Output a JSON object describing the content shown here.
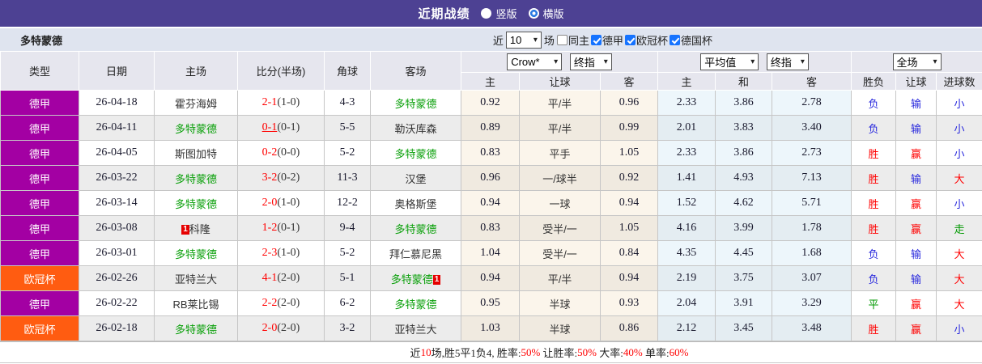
{
  "title_bar": {
    "title": "近期战绩",
    "radio_vertical": "竖版",
    "radio_horizontal": "横版"
  },
  "toolbar": {
    "team_name": "多特蒙德",
    "recent_label": "近",
    "recent_count": "10",
    "matches_label": "场",
    "filters": [
      {
        "label": "同主",
        "checked": false
      },
      {
        "label": "德甲",
        "checked": true
      },
      {
        "label": "欧冠杯",
        "checked": true
      },
      {
        "label": "德国杯",
        "checked": true
      }
    ]
  },
  "table": {
    "columns_left": [
      "类型",
      "日期",
      "主场",
      "比分(半场)",
      "角球",
      "客场"
    ],
    "odds_selects": {
      "asian_company": "Crow*",
      "asian_stage": "终指",
      "euro_company": "平均值",
      "euro_stage": "终指",
      "result_scope": "全场"
    },
    "sub_headers": [
      "主",
      "让球",
      "客",
      "主",
      "和",
      "客",
      "胜负",
      "让球",
      "进球数"
    ],
    "rows": [
      {
        "league": "德甲",
        "date": "26-04-18",
        "home": {
          "name": "霍芬海姆",
          "green": false
        },
        "score": "2-1",
        "half": "(1-0)",
        "score_underline": false,
        "corner": "4-3",
        "away": {
          "name": "多特蒙德",
          "green": true
        },
        "asian": [
          "0.92",
          "平/半",
          "0.96"
        ],
        "euro": [
          "2.33",
          "3.86",
          "2.78"
        ],
        "results": [
          {
            "text": "负",
            "color": "blue"
          },
          {
            "text": "输",
            "color": "blue"
          },
          {
            "text": "小",
            "color": "blue"
          }
        ]
      },
      {
        "league": "德甲",
        "date": "26-04-11",
        "home": {
          "name": "多特蒙德",
          "green": true
        },
        "score": "0-1",
        "half": "(0-1)",
        "score_underline": true,
        "corner": "5-5",
        "away": {
          "name": "勒沃库森",
          "green": false
        },
        "asian": [
          "0.89",
          "平/半",
          "0.99"
        ],
        "euro": [
          "2.01",
          "3.83",
          "3.40"
        ],
        "results": [
          {
            "text": "负",
            "color": "blue"
          },
          {
            "text": "输",
            "color": "blue"
          },
          {
            "text": "小",
            "color": "blue"
          }
        ]
      },
      {
        "league": "德甲",
        "date": "26-04-05",
        "home": {
          "name": "斯图加特",
          "green": false
        },
        "score": "0-2",
        "half": "(0-0)",
        "score_underline": false,
        "corner": "5-2",
        "away": {
          "name": "多特蒙德",
          "green": true
        },
        "asian": [
          "0.83",
          "平手",
          "1.05"
        ],
        "euro": [
          "2.33",
          "3.86",
          "2.73"
        ],
        "results": [
          {
            "text": "胜",
            "color": "red"
          },
          {
            "text": "赢",
            "color": "red"
          },
          {
            "text": "小",
            "color": "blue"
          }
        ]
      },
      {
        "league": "德甲",
        "date": "26-03-22",
        "home": {
          "name": "多特蒙德",
          "green": true
        },
        "score": "3-2",
        "half": "(0-2)",
        "score_underline": false,
        "corner": "11-3",
        "away": {
          "name": "汉堡",
          "green": false
        },
        "asian": [
          "0.96",
          "一/球半",
          "0.92"
        ],
        "euro": [
          "1.41",
          "4.93",
          "7.13"
        ],
        "results": [
          {
            "text": "胜",
            "color": "red"
          },
          {
            "text": "输",
            "color": "blue"
          },
          {
            "text": "大",
            "color": "red"
          }
        ]
      },
      {
        "league": "德甲",
        "date": "26-03-14",
        "home": {
          "name": "多特蒙德",
          "green": true
        },
        "score": "2-0",
        "half": "(1-0)",
        "score_underline": false,
        "corner": "12-2",
        "away": {
          "name": "奥格斯堡",
          "green": false
        },
        "asian": [
          "0.94",
          "一球",
          "0.94"
        ],
        "euro": [
          "1.52",
          "4.62",
          "5.71"
        ],
        "results": [
          {
            "text": "胜",
            "color": "red"
          },
          {
            "text": "赢",
            "color": "red"
          },
          {
            "text": "小",
            "color": "blue"
          }
        ]
      },
      {
        "league": "德甲",
        "date": "26-03-08",
        "home": {
          "name": "科隆",
          "green": false,
          "red_prefix": "1"
        },
        "score": "1-2",
        "half": "(0-1)",
        "score_underline": false,
        "corner": "9-4",
        "away": {
          "name": "多特蒙德",
          "green": true
        },
        "asian": [
          "0.83",
          "受半/一",
          "1.05"
        ],
        "euro": [
          "4.16",
          "3.99",
          "1.78"
        ],
        "results": [
          {
            "text": "胜",
            "color": "red"
          },
          {
            "text": "赢",
            "color": "red"
          },
          {
            "text": "走",
            "color": "green"
          }
        ]
      },
      {
        "league": "德甲",
        "date": "26-03-01",
        "home": {
          "name": "多特蒙德",
          "green": true
        },
        "score": "2-3",
        "half": "(1-0)",
        "score_underline": false,
        "corner": "5-2",
        "away": {
          "name": "拜仁慕尼黑",
          "green": false
        },
        "asian": [
          "1.04",
          "受半/一",
          "0.84"
        ],
        "euro": [
          "4.35",
          "4.45",
          "1.68"
        ],
        "results": [
          {
            "text": "负",
            "color": "blue"
          },
          {
            "text": "输",
            "color": "blue"
          },
          {
            "text": "大",
            "color": "red"
          }
        ]
      },
      {
        "league": "欧冠杯",
        "date": "26-02-26",
        "home": {
          "name": "亚特兰大",
          "green": false
        },
        "score": "4-1",
        "half": "(2-0)",
        "score_underline": false,
        "corner": "5-1",
        "away": {
          "name": "多特蒙德",
          "green": true,
          "red_suffix": "1"
        },
        "asian": [
          "0.94",
          "平/半",
          "0.94"
        ],
        "euro": [
          "2.19",
          "3.75",
          "3.07"
        ],
        "results": [
          {
            "text": "负",
            "color": "blue"
          },
          {
            "text": "输",
            "color": "blue"
          },
          {
            "text": "大",
            "color": "red"
          }
        ]
      },
      {
        "league": "德甲",
        "date": "26-02-22",
        "home": {
          "name": "RB莱比锡",
          "green": false
        },
        "score": "2-2",
        "half": "(2-0)",
        "score_underline": false,
        "corner": "6-2",
        "away": {
          "name": "多特蒙德",
          "green": true
        },
        "asian": [
          "0.95",
          "半球",
          "0.93"
        ],
        "euro": [
          "2.04",
          "3.91",
          "3.29"
        ],
        "results": [
          {
            "text": "平",
            "color": "green"
          },
          {
            "text": "赢",
            "color": "red"
          },
          {
            "text": "大",
            "color": "red"
          }
        ]
      },
      {
        "league": "欧冠杯",
        "date": "26-02-18",
        "home": {
          "name": "多特蒙德",
          "green": true
        },
        "score": "2-0",
        "half": "(2-0)",
        "score_underline": false,
        "corner": "3-2",
        "away": {
          "name": "亚特兰大",
          "green": false
        },
        "asian": [
          "1.03",
          "半球",
          "0.86"
        ],
        "euro": [
          "2.12",
          "3.45",
          "3.48"
        ],
        "results": [
          {
            "text": "胜",
            "color": "red"
          },
          {
            "text": "赢",
            "color": "red"
          },
          {
            "text": "小",
            "color": "blue"
          }
        ]
      }
    ]
  },
  "footer": {
    "segments": [
      {
        "text": "近",
        "color": "black"
      },
      {
        "text": "10",
        "color": "red"
      },
      {
        "text": "场,胜5平1负4, 胜率:",
        "color": "black"
      },
      {
        "text": "50%",
        "color": "red"
      },
      {
        "text": " 让胜率:",
        "color": "black"
      },
      {
        "text": "50%",
        "color": "red"
      },
      {
        "text": " 大率:",
        "color": "black"
      },
      {
        "text": "40%",
        "color": "red"
      },
      {
        "text": " 单率:",
        "color": "black"
      },
      {
        "text": "60%",
        "color": "red"
      }
    ]
  },
  "colors": {
    "title_bar_bg": "#4d4193",
    "toolbar_bg": "#dfe4ef",
    "header_bg": "#e6e6ee",
    "score_red": "#ff0000",
    "result_red": "#ff0000",
    "result_blue": "#2828dd",
    "result_green": "#009900",
    "team_green": "#0aa00a",
    "league": {
      "德甲": "#a300a3",
      "欧冠杯": "#ff5c11"
    }
  }
}
